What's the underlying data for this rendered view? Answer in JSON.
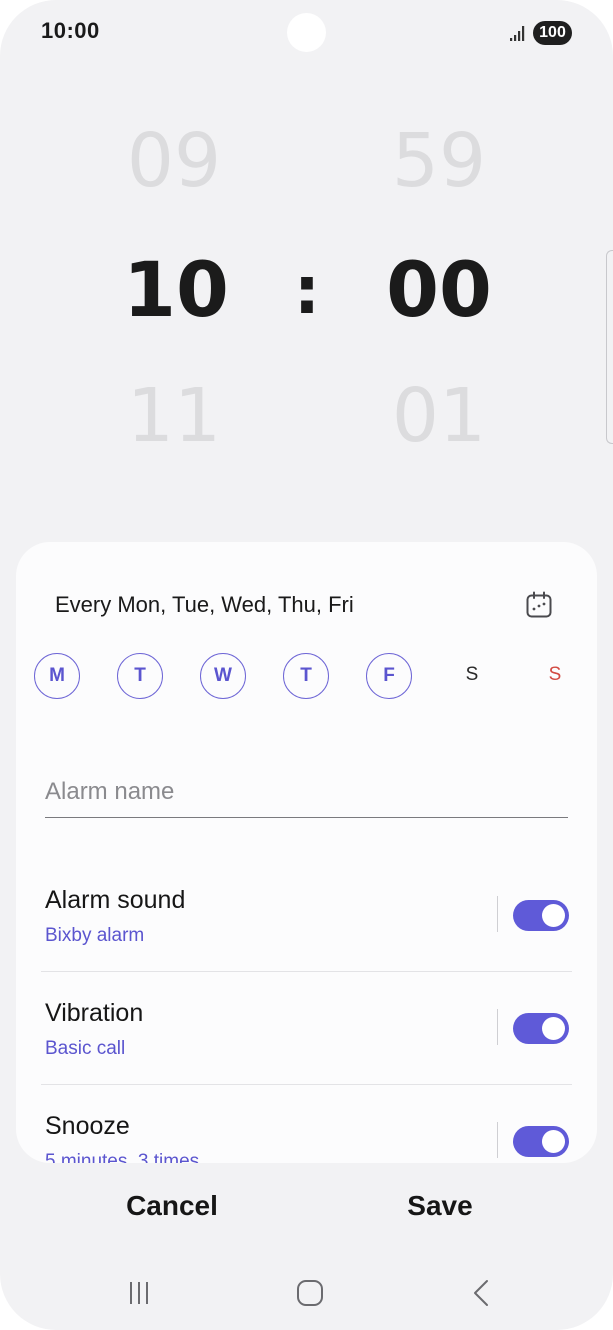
{
  "status_bar": {
    "time": "10:00",
    "battery": "100",
    "icons": [
      "signal-icon",
      "battery-icon"
    ]
  },
  "time_picker": {
    "hour_prev": "09",
    "hour": "10",
    "hour_next": "11",
    "separator": ":",
    "minute_prev": "59",
    "minute": "00",
    "minute_next": "01"
  },
  "repeat": {
    "summary": "Every Mon, Tue, Wed, Thu, Fri",
    "calendar_icon": "calendar-icon"
  },
  "days": [
    {
      "label": "M",
      "selected": true
    },
    {
      "label": "T",
      "selected": true
    },
    {
      "label": "W",
      "selected": true
    },
    {
      "label": "T",
      "selected": true
    },
    {
      "label": "F",
      "selected": true
    },
    {
      "label": "S",
      "selected": false
    },
    {
      "label": "S",
      "selected": false
    }
  ],
  "alarm_name": {
    "value": "",
    "placeholder": "Alarm name"
  },
  "settings": {
    "alarm_sound": {
      "title": "Alarm sound",
      "subtitle": "Bixby alarm",
      "enabled": true
    },
    "vibration": {
      "title": "Vibration",
      "subtitle": "Basic call",
      "enabled": true
    },
    "snooze": {
      "title": "Snooze",
      "subtitle": "5 minutes, 3 times",
      "enabled": true
    }
  },
  "colors": {
    "accent": "#5f5ad8",
    "sunday": "#d24a42",
    "background": "#f2f2f4",
    "card": "#fcfcfd"
  },
  "buttons": {
    "cancel": "Cancel",
    "save": "Save"
  },
  "nav_bar": {
    "icons": [
      "recent-apps-icon",
      "home-icon",
      "back-icon"
    ]
  }
}
